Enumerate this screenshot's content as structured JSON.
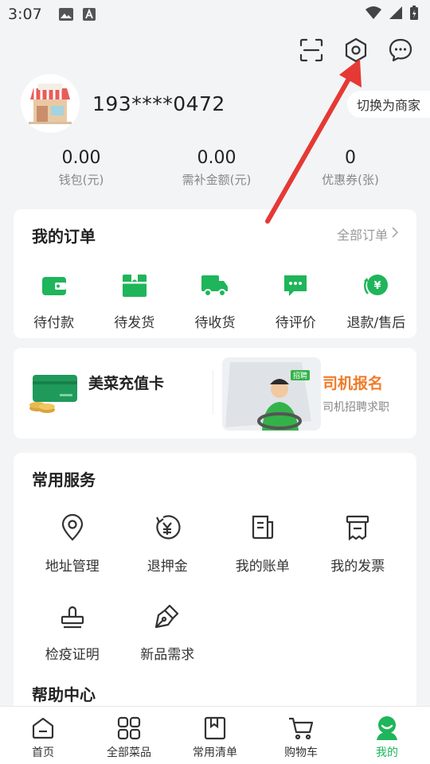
{
  "status_bar": {
    "time": "3:07"
  },
  "colors": {
    "brand_green": "#1fb55a",
    "orange": "#f07b2a",
    "arrow_red": "#e53935"
  },
  "header_icons": [
    "scan-icon",
    "settings-icon",
    "message-icon"
  ],
  "profile": {
    "phone": "193****0472",
    "switch_label": "切换为商家"
  },
  "stats": [
    {
      "value": "0.00",
      "label": "钱包(元)"
    },
    {
      "value": "0.00",
      "label": "需补金额(元)"
    },
    {
      "value": "0",
      "label": "优惠券(张)"
    }
  ],
  "orders": {
    "title": "我的订单",
    "all_link": "全部订单",
    "items": [
      {
        "label": "待付款",
        "icon": "wallet-icon"
      },
      {
        "label": "待发货",
        "icon": "gift-box-icon"
      },
      {
        "label": "待收货",
        "icon": "truck-icon"
      },
      {
        "label": "待评价",
        "icon": "comment-icon"
      },
      {
        "label": "退款/售后",
        "icon": "refund-icon"
      }
    ]
  },
  "promo": {
    "recharge_title": "美菜充值卡",
    "driver_title": "司机报名",
    "driver_subtitle": "司机招聘求职",
    "driver_badge": "招聘"
  },
  "services": {
    "title": "常用服务",
    "items": [
      {
        "label": "地址管理",
        "icon": "location-icon"
      },
      {
        "label": "退押金",
        "icon": "deposit-refund-icon"
      },
      {
        "label": "我的账单",
        "icon": "bill-icon"
      },
      {
        "label": "我的发票",
        "icon": "invoice-icon"
      },
      {
        "label": "检疫证明",
        "icon": "stamp-icon"
      },
      {
        "label": "新品需求",
        "icon": "pen-icon"
      }
    ],
    "help_title": "帮助中心"
  },
  "tabs": [
    {
      "label": "首页",
      "icon": "home-icon",
      "active": false
    },
    {
      "label": "全部菜品",
      "icon": "grid-icon",
      "active": false
    },
    {
      "label": "常用清单",
      "icon": "bookmark-list-icon",
      "active": false
    },
    {
      "label": "购物车",
      "icon": "cart-icon",
      "active": false
    },
    {
      "label": "我的",
      "icon": "user-icon",
      "active": true
    }
  ]
}
